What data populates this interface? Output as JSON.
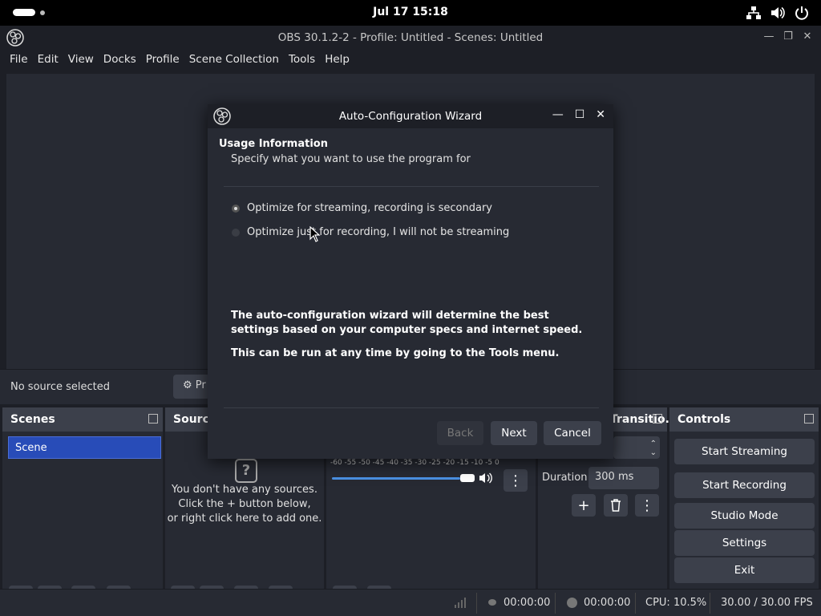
{
  "system": {
    "clock": "Jul 17  15:18"
  },
  "window": {
    "title": "OBS 30.1.2-2 - Profile: Untitled - Scenes: Untitled"
  },
  "menu": [
    "File",
    "Edit",
    "View",
    "Docks",
    "Profile",
    "Scene Collection",
    "Tools",
    "Help"
  ],
  "source_bar": {
    "status": "No source selected",
    "properties_label": "Pr"
  },
  "docks": {
    "scenes": {
      "title": "Scenes",
      "items": [
        "Scene"
      ]
    },
    "sources": {
      "title": "Sourc",
      "empty_line1": "You don't have any sources.",
      "empty_line2": "Click the + button below,",
      "empty_line3": "or right click here to add one."
    },
    "mixer": {
      "scale": "-60 -55 -50 -45 -40 -35 -30 -25 -20 -15 -10  -5   0",
      "volume_level": 0.93
    },
    "transitions": {
      "title": "Transitio...",
      "duration_label": "Duration",
      "duration_value": "300 ms"
    },
    "controls": {
      "title": "Controls",
      "buttons": [
        "Start Streaming",
        "Start Recording",
        "Studio Mode",
        "Settings",
        "Exit"
      ]
    }
  },
  "status": {
    "stream_time": "00:00:00",
    "rec_time": "00:00:00",
    "cpu": "CPU: 10.5%",
    "fps": "30.00 / 30.00 FPS"
  },
  "wizard": {
    "title": "Auto-Configuration Wizard",
    "heading": "Usage Information",
    "subheading": "Specify what you want to use the program for",
    "option_streaming": "Optimize for streaming, recording is secondary",
    "option_recording": "Optimize just for recording, I will not be streaming",
    "selected": "streaming",
    "note1": "The auto-configuration wizard will determine the best settings based on your computer specs and internet speed.",
    "note2": "This can be run at any time by going to the Tools menu.",
    "back_label": "Back",
    "next_label": "Next",
    "cancel_label": "Cancel"
  },
  "colors": {
    "accent": "#284cb8",
    "dock_bg": "#272a33",
    "dock_header": "#3c404b",
    "window_bg": "#1d1f26"
  }
}
